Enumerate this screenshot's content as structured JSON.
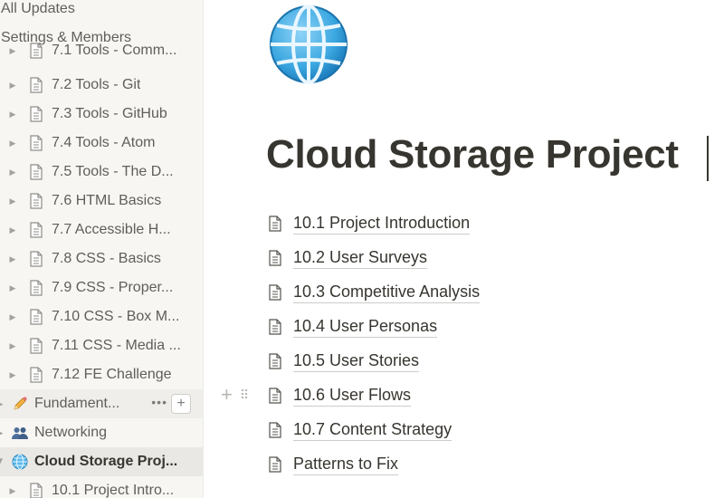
{
  "sidebar": {
    "top_links": [
      "All Updates",
      "Settings & Members"
    ],
    "items": [
      {
        "label": "7.1 Tools - Comm..."
      },
      {
        "label": "7.2 Tools - Git"
      },
      {
        "label": "7.3 Tools - GitHub"
      },
      {
        "label": "7.4 Tools - Atom"
      },
      {
        "label": "7.5 Tools - The D..."
      },
      {
        "label": "7.6 HTML Basics"
      },
      {
        "label": "7.7 Accessible H..."
      },
      {
        "label": "7.8 CSS - Basics"
      },
      {
        "label": "7.9 CSS - Proper..."
      },
      {
        "label": "7.10 CSS - Box M..."
      },
      {
        "label": "7.11 CSS - Media ..."
      },
      {
        "label": "7.12 FE Challenge"
      }
    ],
    "fundamentals": {
      "label": "Fundament...",
      "more": "•••",
      "add": "+",
      "icon": "pencil-icon"
    },
    "networking": {
      "label": "Networking",
      "icon": "people-icon"
    },
    "cloud": {
      "label": "Cloud Storage Proj...",
      "icon": "globe-icon"
    },
    "child": {
      "label": "10.1 Project Intro..."
    }
  },
  "main": {
    "icon": "globe-icon",
    "title": "Cloud Storage Project",
    "links": [
      "10.1 Project Introduction",
      "10.2 User Surveys",
      "10.3 Competitive Analysis",
      "10.4 User Personas",
      "10.5 User Stories",
      "10.6 User Flows",
      "10.7 Content Strategy",
      "Patterns to Fix"
    ]
  },
  "colors": {
    "sidebar_bg": "#f7f6f3",
    "selected_bg": "#e9e8e4",
    "text": "#37352f",
    "globe_blue": "#3aa7e0"
  }
}
